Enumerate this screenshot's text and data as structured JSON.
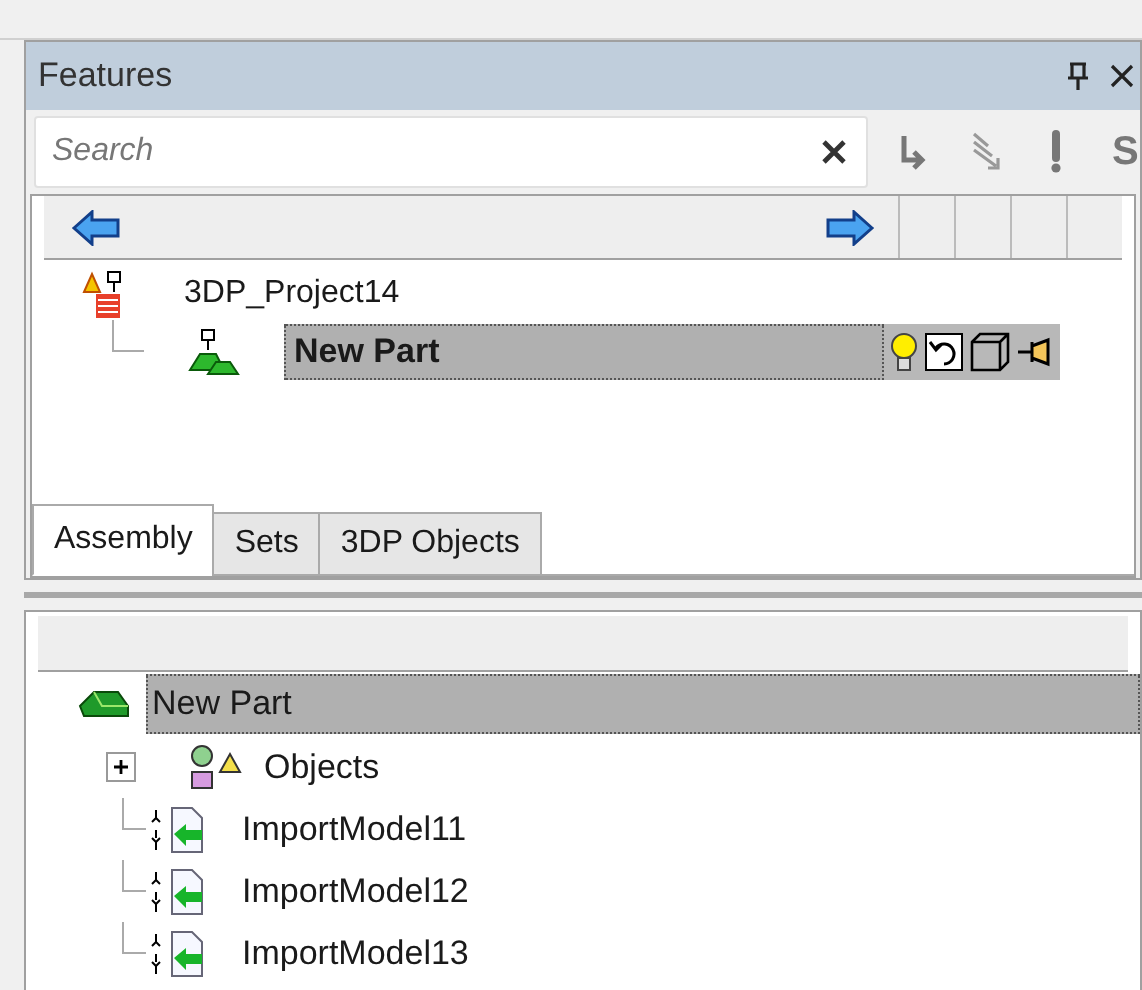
{
  "panel": {
    "title": "Features",
    "search_placeholder": "Search",
    "toolbar_text": "S"
  },
  "assembly_tree": [
    {
      "label": "3DP_Project14",
      "children": [
        {
          "label": "New Part",
          "selected": true
        }
      ]
    }
  ],
  "tabs": [
    {
      "label": "Assembly",
      "selected": true
    },
    {
      "label": "Sets",
      "selected": false
    },
    {
      "label": "3DP Objects",
      "selected": false
    }
  ],
  "object_tree": {
    "label": "New Part",
    "selected": true,
    "children": [
      {
        "label": "Objects",
        "kind": "group",
        "expanded": false
      },
      {
        "label": "ImportModel11",
        "kind": "import"
      },
      {
        "label": "ImportModel12",
        "kind": "import"
      },
      {
        "label": "ImportModel13",
        "kind": "import"
      }
    ]
  }
}
